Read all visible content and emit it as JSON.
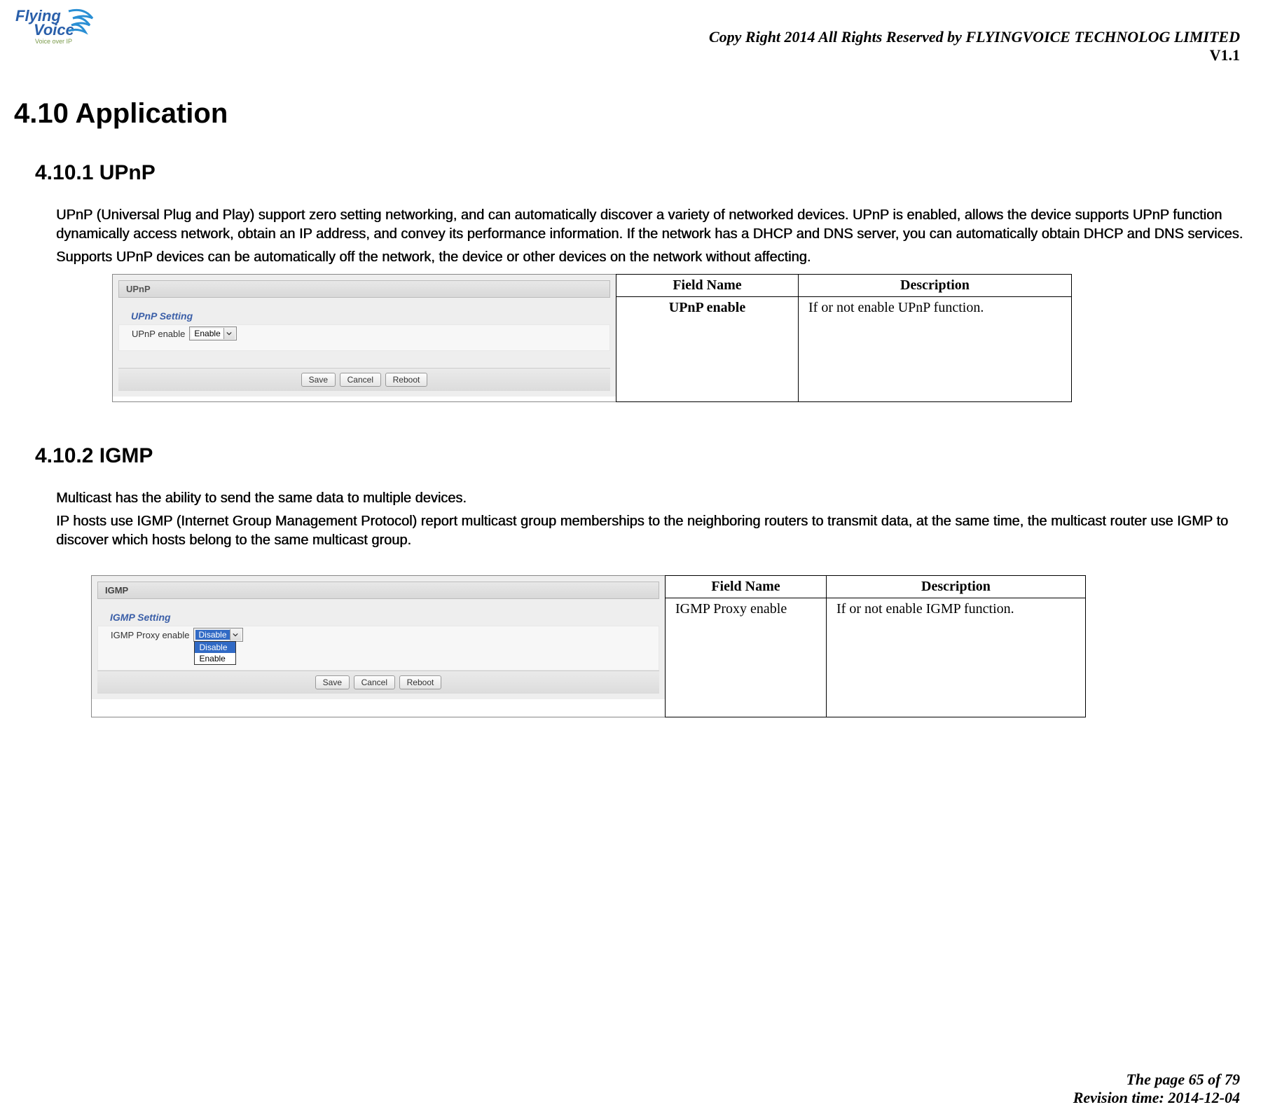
{
  "header": {
    "copyright": "Copy Right 2014 All Rights Reserved by FLYINGVOICE TECHNOLOG LIMITED",
    "version": "V1.1",
    "logo_main": "Flying",
    "logo_sub": "Voice",
    "logo_tag": "Voice over IP"
  },
  "headings": {
    "h1": "4.10  Application",
    "h2_upnp": "4.10.1  UPnP",
    "h2_igmp": "4.10.2   IGMP"
  },
  "upnp": {
    "para1": "UPnP (Universal Plug and Play) support zero setting networking, and can automatically discover a variety of networked devices. UPnP is enabled, allows the device supports UPnP function dynamically access network, obtain an IP address, and convey its performance information. If the network has a DHCP and DNS server, you can automatically obtain DHCP and DNS services.",
    "para2": "Supports UPnP devices can be automatically off the network, the device or other devices on the network without affecting.",
    "panel_title": "UPnP",
    "panel_subtitle": "UPnP Setting",
    "field_label": "UPnP enable",
    "dropdown_value": "Enable",
    "buttons": {
      "save": "Save",
      "cancel": "Cancel",
      "reboot": "Reboot"
    },
    "table": {
      "h_field": "Field Name",
      "h_desc": "Description",
      "r1_field": "UPnP enable",
      "r1_desc": "If or not enable UPnP function."
    }
  },
  "igmp": {
    "para1": "Multicast has the ability to send the same data to multiple devices.",
    "para2": "IP hosts use IGMP (Internet Group Management Protocol) report multicast group memberships to the neighboring routers to transmit data, at the same time, the multicast router use IGMP to discover which hosts belong to the same multicast group.",
    "panel_title": "IGMP",
    "panel_subtitle": "IGMP Setting",
    "field_label": "IGMP Proxy enable",
    "dropdown_value": "Disable",
    "dropdown_opts": {
      "o1": "Disable",
      "o2": "Enable"
    },
    "buttons": {
      "save": "Save",
      "cancel": "Cancel",
      "reboot": "Reboot"
    },
    "table": {
      "h_field": "Field Name",
      "h_desc": "Description",
      "r1_field": "IGMP Proxy enable",
      "r1_desc": "If or not enable IGMP function."
    }
  },
  "footer": {
    "page": "The page 65 of 79",
    "revision": "Revision time: 2014-12-04"
  }
}
